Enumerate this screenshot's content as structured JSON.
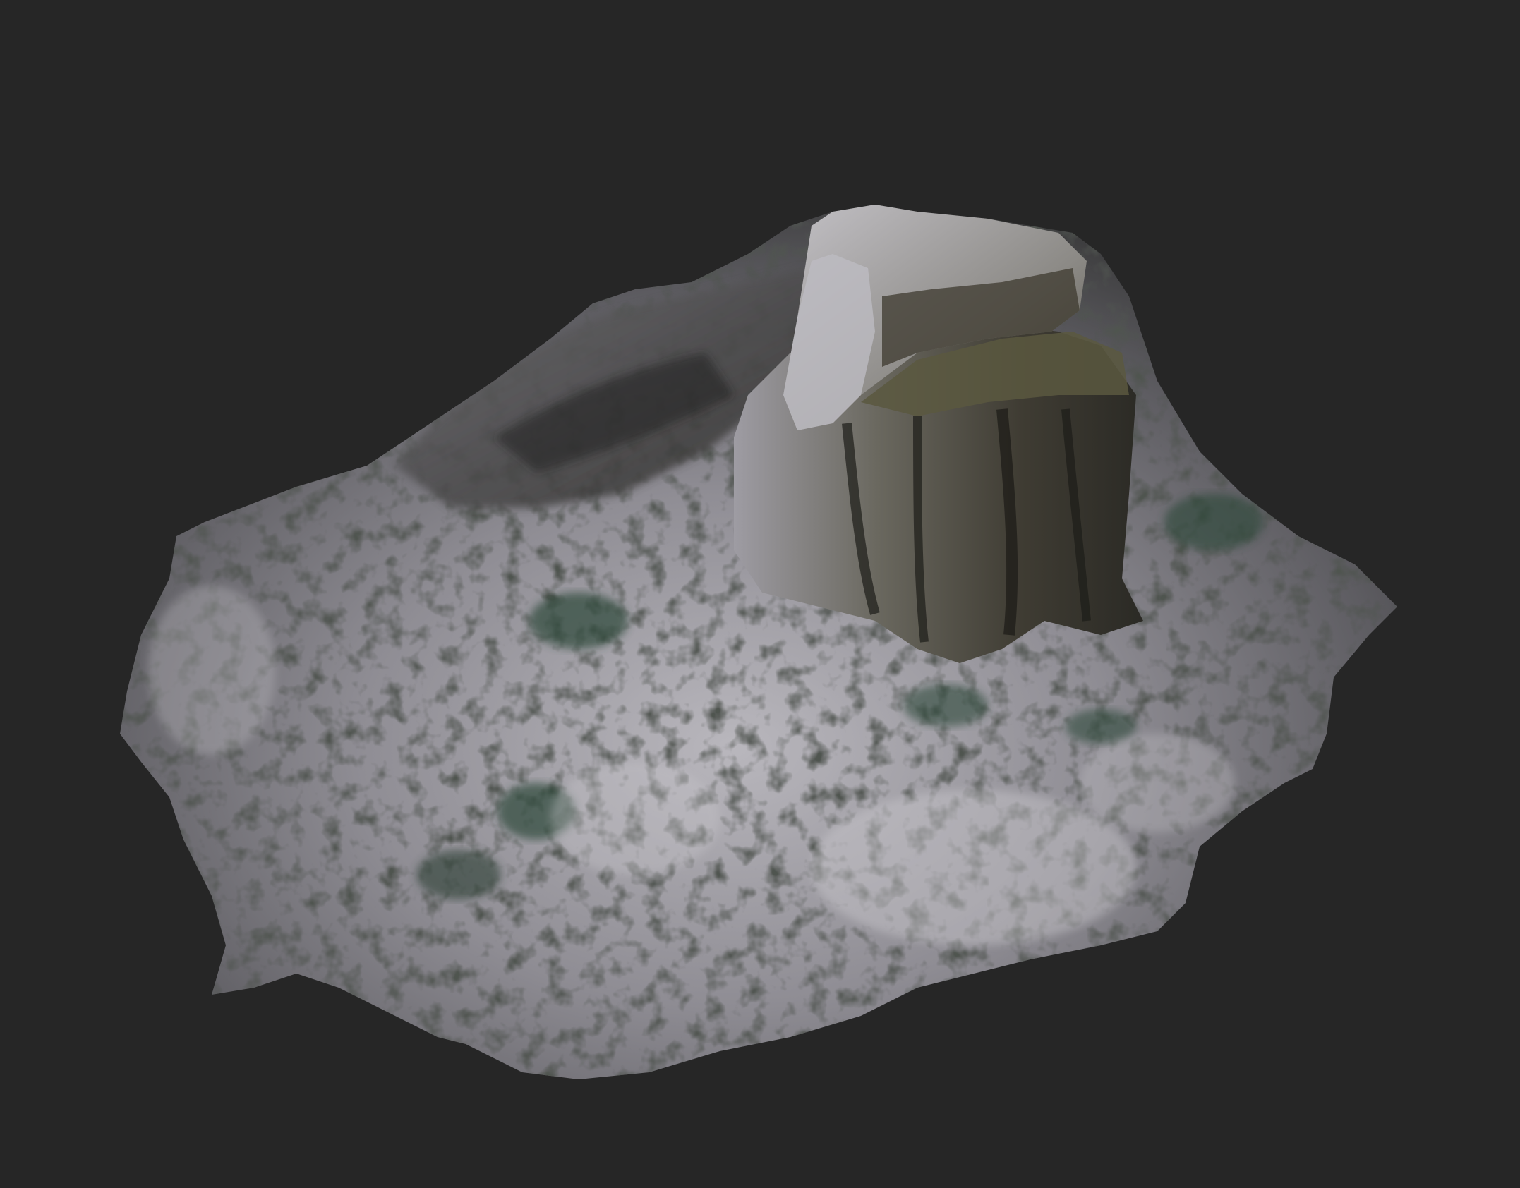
{
  "viewport": {
    "background_color": "#262626",
    "model": {
      "surface_light": "#c9c7cc",
      "surface_mid": "#8d8b91",
      "surface_dark": "#3a3a37",
      "moss_green": "#2f4a3a",
      "bark_brown": "#4a4334",
      "shadow": "#151614"
    }
  }
}
